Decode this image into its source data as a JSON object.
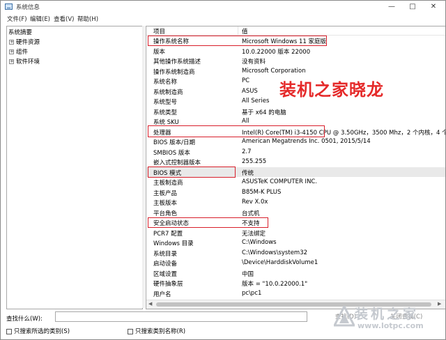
{
  "window": {
    "title": "系统信息",
    "controls": {
      "minimize": "—",
      "maximize": "□",
      "close": "✕"
    }
  },
  "menu": [
    {
      "label": "文件(F)"
    },
    {
      "label": "编辑(E)"
    },
    {
      "label": "查看(V)"
    },
    {
      "label": "帮助(H)"
    }
  ],
  "tree": {
    "root": "系统摘要",
    "items": [
      {
        "label": "硬件资源",
        "expander": "+"
      },
      {
        "label": "组件",
        "expander": "+"
      },
      {
        "label": "软件环境",
        "expander": "+"
      }
    ]
  },
  "table": {
    "headers": {
      "item": "项目",
      "value": "值"
    },
    "rows": [
      {
        "label": "操作系统名称",
        "value": "Microsoft Windows 11 家庭版"
      },
      {
        "label": "版本",
        "value": "10.0.22000 版本 22000"
      },
      {
        "label": "其他操作系统描述",
        "value": "没有资料"
      },
      {
        "label": "操作系统制造商",
        "value": "Microsoft Corporation"
      },
      {
        "label": "系统名称",
        "value": "PC"
      },
      {
        "label": "系统制造商",
        "value": "ASUS"
      },
      {
        "label": "系统型号",
        "value": "All Series"
      },
      {
        "label": "系统类型",
        "value": "基于 x64 的电脑"
      },
      {
        "label": "系统 SKU",
        "value": "All"
      },
      {
        "label": "处理器",
        "value": "Intel(R) Core(TM) i3-4150 CPU @ 3.50GHz，3500 Mhz，2 个内核，4 个"
      },
      {
        "label": "BIOS 版本/日期",
        "value": "American Megatrends Inc. 0501, 2015/5/14"
      },
      {
        "label": "SMBIOS 版本",
        "value": "2.7"
      },
      {
        "label": "嵌入式控制器版本",
        "value": "255.255"
      },
      {
        "label": "BIOS 模式",
        "value": "传统"
      },
      {
        "label": "主板制造商",
        "value": "ASUSTeK COMPUTER INC."
      },
      {
        "label": "主板产品",
        "value": "B85M-K PLUS"
      },
      {
        "label": "主板版本",
        "value": "Rev X.0x"
      },
      {
        "label": "平台角色",
        "value": "台式机"
      },
      {
        "label": "安全启动状态",
        "value": "不支持"
      },
      {
        "label": "PCR7 配置",
        "value": "无法绑定"
      },
      {
        "label": "Windows 目录",
        "value": "C:\\Windows"
      },
      {
        "label": "系统目录",
        "value": "C:\\Windows\\system32"
      },
      {
        "label": "启动设备",
        "value": "\\Device\\HarddiskVolume1"
      },
      {
        "label": "区域设置",
        "value": "中国"
      },
      {
        "label": "硬件抽象层",
        "value": "版本 = \"10.0.22000.1\""
      },
      {
        "label": "用户名",
        "value": "pc\\pc1"
      }
    ]
  },
  "find": {
    "label": "查找什么(W):",
    "value": "",
    "find_button": "查找(D)",
    "close_find_button": "关闭查找(C)",
    "only_selected": "只搜索所选的类别(S)",
    "only_names": "只搜索类别名称(R)"
  },
  "watermark": {
    "text": "装机之家晓龙",
    "color": "#e52a2a"
  },
  "logo": {
    "name": "装机之家",
    "url": "www.lotpc.com"
  },
  "colors": {
    "highlight_box": "#d81e2a",
    "selected_row": "#e9e9e9"
  }
}
